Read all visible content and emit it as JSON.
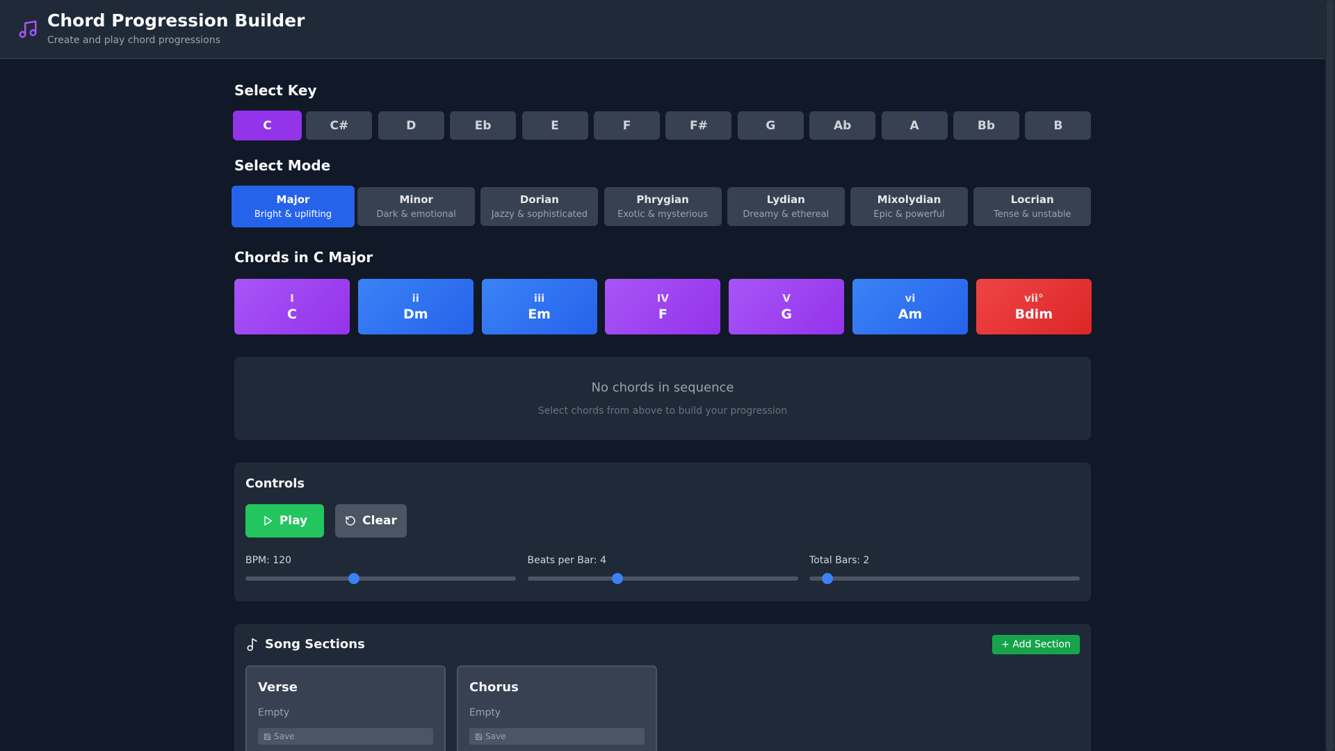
{
  "header": {
    "title": "Chord Progression Builder",
    "subtitle": "Create and play chord progressions",
    "icon": "music-note-icon",
    "accent": "#a855f7"
  },
  "key_section": {
    "title": "Select Key",
    "keys": [
      "C",
      "C#",
      "D",
      "Eb",
      "E",
      "F",
      "F#",
      "G",
      "Ab",
      "A",
      "Bb",
      "B"
    ],
    "selected": "C",
    "active_color": "#9333ea"
  },
  "mode_section": {
    "title": "Select Mode",
    "modes": [
      {
        "name": "Major",
        "desc": "Bright & uplifting"
      },
      {
        "name": "Minor",
        "desc": "Dark & emotional"
      },
      {
        "name": "Dorian",
        "desc": "Jazzy & sophisticated"
      },
      {
        "name": "Phrygian",
        "desc": "Exotic & mysterious"
      },
      {
        "name": "Lydian",
        "desc": "Dreamy & ethereal"
      },
      {
        "name": "Mixolydian",
        "desc": "Epic & powerful"
      },
      {
        "name": "Locrian",
        "desc": "Tense & unstable"
      }
    ],
    "selected": "Major",
    "active_color": "#2563eb"
  },
  "chord_section": {
    "title": "Chords in C Major",
    "chords": [
      {
        "roman": "I",
        "name": "C",
        "color": "#a855f7"
      },
      {
        "roman": "ii",
        "name": "Dm",
        "color": "#3b82f6"
      },
      {
        "roman": "iii",
        "name": "Em",
        "color": "#3b82f6"
      },
      {
        "roman": "IV",
        "name": "F",
        "color": "#a855f7"
      },
      {
        "roman": "V",
        "name": "G",
        "color": "#a855f7"
      },
      {
        "roman": "vi",
        "name": "Am",
        "color": "#3b82f6"
      },
      {
        "roman": "vii°",
        "name": "Bdim",
        "color": "#ef4444"
      }
    ]
  },
  "sequence": {
    "empty_title": "No chords in sequence",
    "empty_hint": "Select chords from above to build your progression"
  },
  "controls": {
    "title": "Controls",
    "play_label": "Play",
    "clear_label": "Clear",
    "sliders": [
      {
        "label": "BPM: 120",
        "value": 120,
        "min": 40,
        "max": 240
      },
      {
        "label": "Beats per Bar: 4",
        "value": 4,
        "min": 1,
        "max": 10
      },
      {
        "label": "Total Bars: 2",
        "value": 2,
        "min": 1,
        "max": 16
      }
    ]
  },
  "song_sections": {
    "title": "Song Sections",
    "add_label": "+ Add Section",
    "sections": [
      {
        "name": "Verse",
        "status": "Empty",
        "save_label": "Save"
      },
      {
        "name": "Chorus",
        "status": "Empty",
        "save_label": "Save"
      }
    ]
  }
}
